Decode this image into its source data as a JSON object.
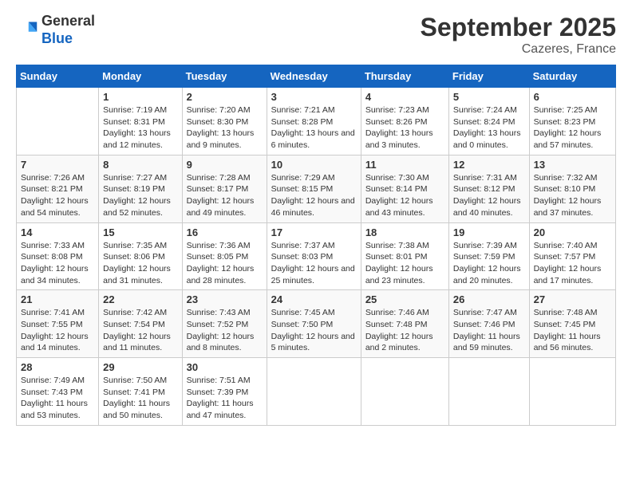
{
  "logo": {
    "line1": "General",
    "line2": "Blue"
  },
  "title": "September 2025",
  "subtitle": "Cazeres, France",
  "days_of_week": [
    "Sunday",
    "Monday",
    "Tuesday",
    "Wednesday",
    "Thursday",
    "Friday",
    "Saturday"
  ],
  "weeks": [
    [
      {
        "day": "",
        "sunrise": "",
        "sunset": "",
        "daylight": ""
      },
      {
        "day": "1",
        "sunrise": "Sunrise: 7:19 AM",
        "sunset": "Sunset: 8:31 PM",
        "daylight": "Daylight: 13 hours and 12 minutes."
      },
      {
        "day": "2",
        "sunrise": "Sunrise: 7:20 AM",
        "sunset": "Sunset: 8:30 PM",
        "daylight": "Daylight: 13 hours and 9 minutes."
      },
      {
        "day": "3",
        "sunrise": "Sunrise: 7:21 AM",
        "sunset": "Sunset: 8:28 PM",
        "daylight": "Daylight: 13 hours and 6 minutes."
      },
      {
        "day": "4",
        "sunrise": "Sunrise: 7:23 AM",
        "sunset": "Sunset: 8:26 PM",
        "daylight": "Daylight: 13 hours and 3 minutes."
      },
      {
        "day": "5",
        "sunrise": "Sunrise: 7:24 AM",
        "sunset": "Sunset: 8:24 PM",
        "daylight": "Daylight: 13 hours and 0 minutes."
      },
      {
        "day": "6",
        "sunrise": "Sunrise: 7:25 AM",
        "sunset": "Sunset: 8:23 PM",
        "daylight": "Daylight: 12 hours and 57 minutes."
      }
    ],
    [
      {
        "day": "7",
        "sunrise": "Sunrise: 7:26 AM",
        "sunset": "Sunset: 8:21 PM",
        "daylight": "Daylight: 12 hours and 54 minutes."
      },
      {
        "day": "8",
        "sunrise": "Sunrise: 7:27 AM",
        "sunset": "Sunset: 8:19 PM",
        "daylight": "Daylight: 12 hours and 52 minutes."
      },
      {
        "day": "9",
        "sunrise": "Sunrise: 7:28 AM",
        "sunset": "Sunset: 8:17 PM",
        "daylight": "Daylight: 12 hours and 49 minutes."
      },
      {
        "day": "10",
        "sunrise": "Sunrise: 7:29 AM",
        "sunset": "Sunset: 8:15 PM",
        "daylight": "Daylight: 12 hours and 46 minutes."
      },
      {
        "day": "11",
        "sunrise": "Sunrise: 7:30 AM",
        "sunset": "Sunset: 8:14 PM",
        "daylight": "Daylight: 12 hours and 43 minutes."
      },
      {
        "day": "12",
        "sunrise": "Sunrise: 7:31 AM",
        "sunset": "Sunset: 8:12 PM",
        "daylight": "Daylight: 12 hours and 40 minutes."
      },
      {
        "day": "13",
        "sunrise": "Sunrise: 7:32 AM",
        "sunset": "Sunset: 8:10 PM",
        "daylight": "Daylight: 12 hours and 37 minutes."
      }
    ],
    [
      {
        "day": "14",
        "sunrise": "Sunrise: 7:33 AM",
        "sunset": "Sunset: 8:08 PM",
        "daylight": "Daylight: 12 hours and 34 minutes."
      },
      {
        "day": "15",
        "sunrise": "Sunrise: 7:35 AM",
        "sunset": "Sunset: 8:06 PM",
        "daylight": "Daylight: 12 hours and 31 minutes."
      },
      {
        "day": "16",
        "sunrise": "Sunrise: 7:36 AM",
        "sunset": "Sunset: 8:05 PM",
        "daylight": "Daylight: 12 hours and 28 minutes."
      },
      {
        "day": "17",
        "sunrise": "Sunrise: 7:37 AM",
        "sunset": "Sunset: 8:03 PM",
        "daylight": "Daylight: 12 hours and 25 minutes."
      },
      {
        "day": "18",
        "sunrise": "Sunrise: 7:38 AM",
        "sunset": "Sunset: 8:01 PM",
        "daylight": "Daylight: 12 hours and 23 minutes."
      },
      {
        "day": "19",
        "sunrise": "Sunrise: 7:39 AM",
        "sunset": "Sunset: 7:59 PM",
        "daylight": "Daylight: 12 hours and 20 minutes."
      },
      {
        "day": "20",
        "sunrise": "Sunrise: 7:40 AM",
        "sunset": "Sunset: 7:57 PM",
        "daylight": "Daylight: 12 hours and 17 minutes."
      }
    ],
    [
      {
        "day": "21",
        "sunrise": "Sunrise: 7:41 AM",
        "sunset": "Sunset: 7:55 PM",
        "daylight": "Daylight: 12 hours and 14 minutes."
      },
      {
        "day": "22",
        "sunrise": "Sunrise: 7:42 AM",
        "sunset": "Sunset: 7:54 PM",
        "daylight": "Daylight: 12 hours and 11 minutes."
      },
      {
        "day": "23",
        "sunrise": "Sunrise: 7:43 AM",
        "sunset": "Sunset: 7:52 PM",
        "daylight": "Daylight: 12 hours and 8 minutes."
      },
      {
        "day": "24",
        "sunrise": "Sunrise: 7:45 AM",
        "sunset": "Sunset: 7:50 PM",
        "daylight": "Daylight: 12 hours and 5 minutes."
      },
      {
        "day": "25",
        "sunrise": "Sunrise: 7:46 AM",
        "sunset": "Sunset: 7:48 PM",
        "daylight": "Daylight: 12 hours and 2 minutes."
      },
      {
        "day": "26",
        "sunrise": "Sunrise: 7:47 AM",
        "sunset": "Sunset: 7:46 PM",
        "daylight": "Daylight: 11 hours and 59 minutes."
      },
      {
        "day": "27",
        "sunrise": "Sunrise: 7:48 AM",
        "sunset": "Sunset: 7:45 PM",
        "daylight": "Daylight: 11 hours and 56 minutes."
      }
    ],
    [
      {
        "day": "28",
        "sunrise": "Sunrise: 7:49 AM",
        "sunset": "Sunset: 7:43 PM",
        "daylight": "Daylight: 11 hours and 53 minutes."
      },
      {
        "day": "29",
        "sunrise": "Sunrise: 7:50 AM",
        "sunset": "Sunset: 7:41 PM",
        "daylight": "Daylight: 11 hours and 50 minutes."
      },
      {
        "day": "30",
        "sunrise": "Sunrise: 7:51 AM",
        "sunset": "Sunset: 7:39 PM",
        "daylight": "Daylight: 11 hours and 47 minutes."
      },
      {
        "day": "",
        "sunrise": "",
        "sunset": "",
        "daylight": ""
      },
      {
        "day": "",
        "sunrise": "",
        "sunset": "",
        "daylight": ""
      },
      {
        "day": "",
        "sunrise": "",
        "sunset": "",
        "daylight": ""
      },
      {
        "day": "",
        "sunrise": "",
        "sunset": "",
        "daylight": ""
      }
    ]
  ]
}
